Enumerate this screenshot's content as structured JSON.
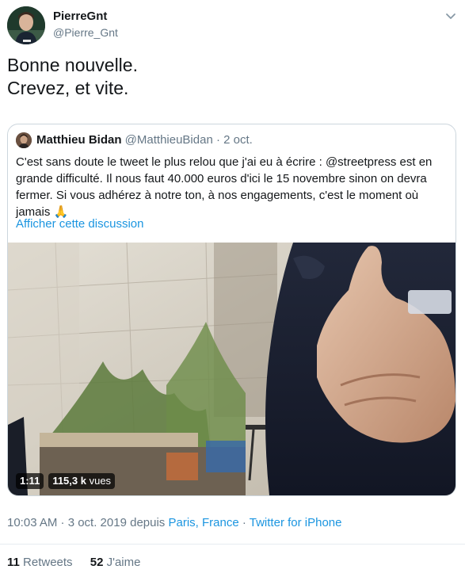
{
  "tweet": {
    "author": {
      "name": "PierreGnt",
      "handle": "@Pierre_Gnt"
    },
    "text_lines": [
      "Bonne nouvelle.",
      "Crevez, et vite."
    ],
    "timestamp": "10:03 AM · 3 oct. 2019",
    "via_prefix": "depuis",
    "location": "Paris, France",
    "client_separator": "·",
    "client": "Twitter for iPhone",
    "retweets": {
      "count": "11",
      "label": "Retweets"
    },
    "likes": {
      "count": "52",
      "label": "J'aime"
    }
  },
  "quoted": {
    "author": {
      "name": "Matthieu Bidan",
      "handle": "@MatthieuBidan"
    },
    "separator": "·",
    "date": "2 oct.",
    "text": "C'est sans doute le tweet le plus relou que j'ai eu à écrire : @streetpress est en grande difficulté. Il nous faut 40.000 euros d'ici le 15 novembre sinon on devra fermer. Si vous adhérez à notre ton, à nos engagements, c'est le moment où jamais 🙏",
    "show_thread": "Afficher cette discussion",
    "video": {
      "duration": "1:11",
      "views": "115,3 k",
      "views_unit": "vues"
    }
  },
  "icons": {
    "more": "chevron-down-icon",
    "author_avatar": "avatar",
    "quoted_avatar": "avatar"
  },
  "colors": {
    "link": "#1b95e0",
    "muted": "#657786",
    "text": "#14171a",
    "border": "#ccd6dd"
  }
}
